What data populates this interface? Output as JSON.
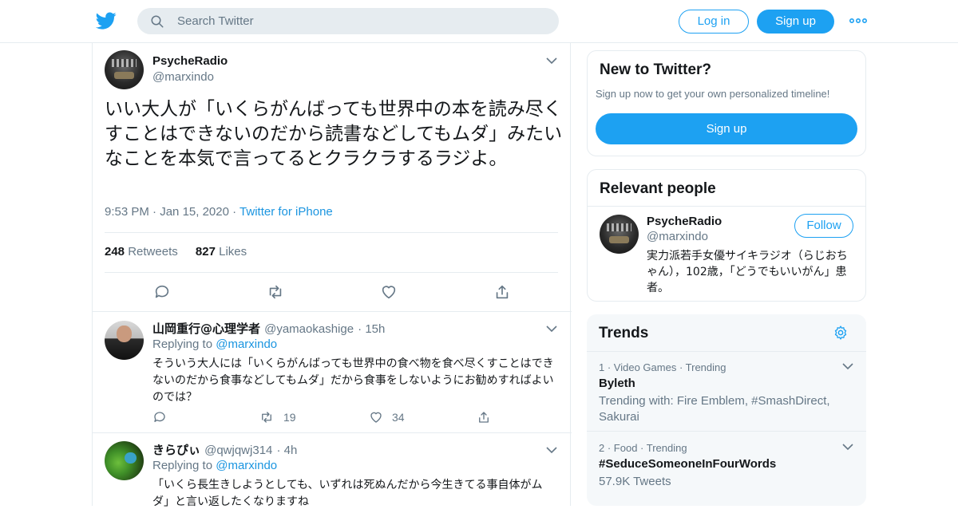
{
  "header": {
    "search_placeholder": "Search Twitter",
    "login_label": "Log in",
    "signup_label": "Sign up",
    "brand_color": "#1da1f2"
  },
  "main_tweet": {
    "display_name": "PsycheRadio",
    "handle": "@marxindo",
    "text": "いい大人が「いくらがんばっても世界中の本を読み尽くすことはできないのだから読書などしてもムダ」みたいなことを本気で言ってるとクラクラするラジよ。",
    "time": "9:53 PM",
    "date": "Jan 15, 2020",
    "source": "Twitter for iPhone",
    "retweets_count": "248",
    "retweets_label": "Retweets",
    "likes_count": "827",
    "likes_label": "Likes"
  },
  "replies": [
    {
      "display_name": "山岡重行@心理学者",
      "handle": "@yamaokashige",
      "time": "15h",
      "replying_label": "Replying to",
      "replying_to": "@marxindo",
      "text": "そういう大人には「いくらがんばっても世界中の食べ物を食べ尽くすことはできないのだから食事などしてもムダ」だから食事をしないようにお勧めすればよいのでは？",
      "retweets": "19",
      "likes": "34"
    },
    {
      "display_name": "きらぴぃ",
      "handle": "@qwjqwj314",
      "time": "4h",
      "replying_label": "Replying to",
      "replying_to": "@marxindo",
      "text": "「いくら長生きしようとしても、いずれは死ぬんだから今生きてる事自体がムダ」と言い返したくなりますね"
    }
  ],
  "new_to_twitter": {
    "title": "New to Twitter?",
    "subtitle": "Sign up now to get your own personalized timeline!",
    "button_label": "Sign up"
  },
  "relevant_people": {
    "title": "Relevant people",
    "display_name": "PsycheRadio",
    "handle": "@marxindo",
    "follow_label": "Follow",
    "bio": "実力派若手女優サイキラジオ（らじおちゃん），102歳，「どうでもいいがん」患者。"
  },
  "trends": {
    "title": "Trends",
    "items": [
      {
        "rank": "1",
        "category": "Video Games",
        "status": "Trending",
        "name": "Byleth",
        "detail": "Trending with: Fire Emblem, #SmashDirect, Sakurai"
      },
      {
        "rank": "2",
        "category": "Food",
        "status": "Trending",
        "name": "#SeduceSomeoneInFourWords",
        "detail": "57.9K Tweets"
      }
    ]
  }
}
